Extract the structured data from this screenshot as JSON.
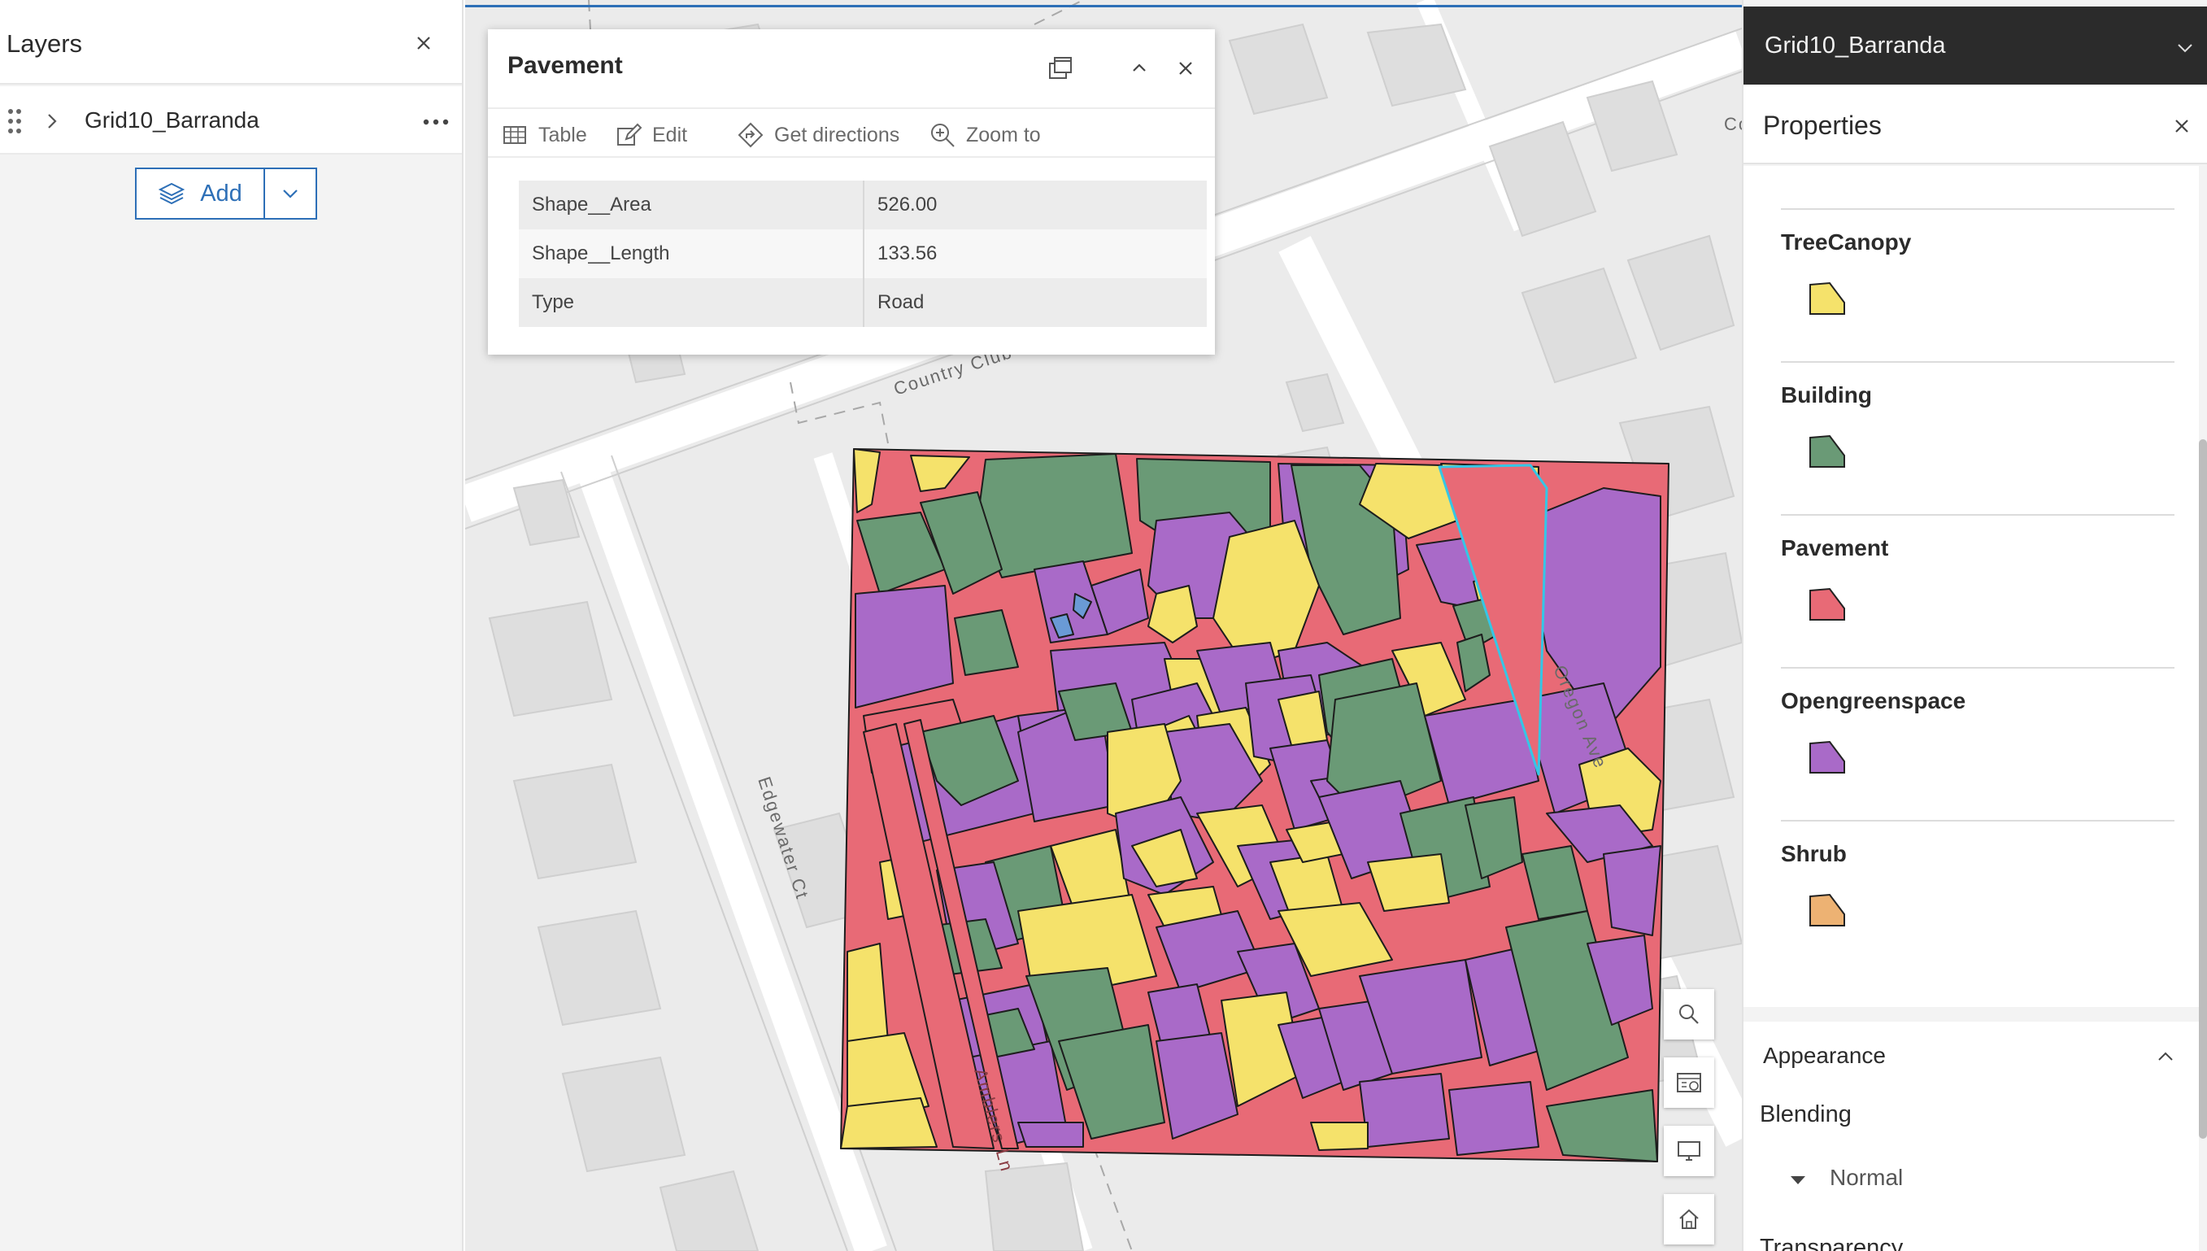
{
  "layers_panel": {
    "title": "Layers",
    "layer_name": "Grid10_Barranda",
    "add_label": "Add"
  },
  "popup": {
    "title": "Pavement",
    "actions": [
      "Table",
      "Edit",
      "Get directions",
      "Zoom to"
    ],
    "attributes": [
      {
        "field": "Shape__Area",
        "value": "526.00"
      },
      {
        "field": "Shape__Length",
        "value": "133.56"
      },
      {
        "field": "Type",
        "value": "Road"
      }
    ]
  },
  "map": {
    "street_labels": [
      "Country Club Blvd",
      "Edgewater Ct",
      "Oregon Ave",
      "Amblers Ln"
    ],
    "partial_label": "Co"
  },
  "properties_panel": {
    "layer_select": "Grid10_Barranda",
    "title": "Properties",
    "legend": [
      {
        "label": "TreeCanopy",
        "color": "#f5e26b"
      },
      {
        "label": "Building",
        "color": "#6a9a76"
      },
      {
        "label": "Pavement",
        "color": "#e86a76"
      },
      {
        "label": "Opengreenspace",
        "color": "#a96ac8"
      },
      {
        "label": "Shrub",
        "color": "#edb273"
      }
    ],
    "appearance": {
      "title": "Appearance",
      "blending_label": "Blending",
      "blending_value": "Normal",
      "transparency_label": "Transparency"
    }
  }
}
